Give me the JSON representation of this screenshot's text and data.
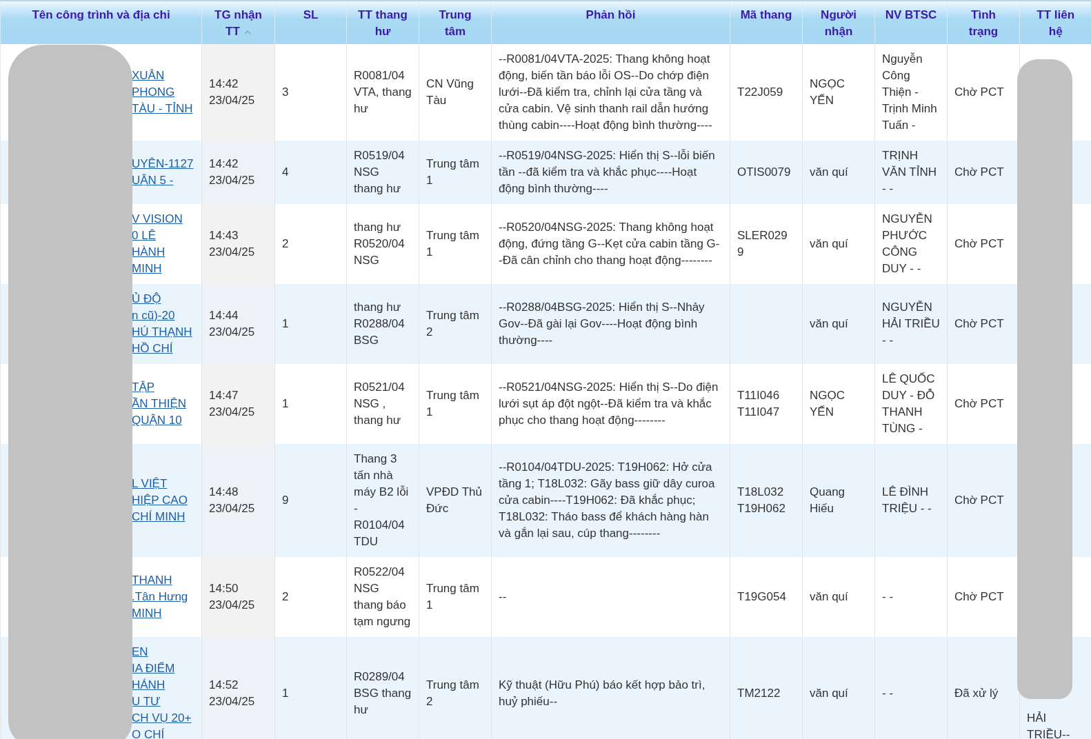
{
  "table": {
    "columns": [
      {
        "label": "Tên công trình và địa chỉ"
      },
      {
        "label": "TG nhận TT",
        "sorted_ascending": true
      },
      {
        "label": "SL"
      },
      {
        "label": "TT thang hư"
      },
      {
        "label": "Trung tâm"
      },
      {
        "label": "Phản hồi"
      },
      {
        "label": "Mã thang"
      },
      {
        "label": "Người nhận"
      },
      {
        "label": "NV BTSC"
      },
      {
        "label": "Tình trạng"
      },
      {
        "label": "TT liên hệ"
      }
    ],
    "rows": [
      {
        "address": [
          "XUÂN",
          "PHONG",
          "TÀU - TỈNH"
        ],
        "time": "14:42",
        "date": "23/04/25",
        "qty": "3",
        "elevator_info": "R0081/04 VTA, thang hư",
        "center": "CN Vũng Tàu",
        "response": "--R0081/04VTA-2025: Thang không hoạt động, biến tần báo lỗi OS--Do chớp điện lưới--Đã kiểm tra, chỉnh lại cửa tầng và cửa cabin. Vệ sinh thanh rail dẫn hướng thùng cabin----Hoạt động bình thường----",
        "code": "T22J059",
        "receiver": "NGỌC YẾN",
        "staff": "Nguyễn Công Thiện - Trịnh Minh Tuấn -",
        "status": "Chờ PCT"
      },
      {
        "address": [
          "UYÊN-1127",
          "UẬN 5 -"
        ],
        "time": "14:42",
        "date": "23/04/25",
        "qty": "4",
        "elevator_info": "R0519/04 NSG thang hư",
        "center": "Trung tâm 1",
        "response": "--R0519/04NSG-2025: Hiển thị S--lỗi biến tần --đã kiểm tra và khắc phục----Hoạt động bình thường----",
        "code": "OTIS0079",
        "receiver": "văn quí",
        "staff": "TRỊNH VĂN TỈNH - -",
        "status": "Chờ PCT"
      },
      {
        "address": [
          "V VISION",
          "0 LÊ",
          "HÀNH",
          "MINH"
        ],
        "time": "14:43",
        "date": "23/04/25",
        "qty": "2",
        "elevator_info": "thang hư R0520/04 NSG",
        "center": "Trung tâm 1",
        "response": "--R0520/04NSG-2025: Thang không hoạt động, đứng tầng G--Kẹt cửa cabin tầng G--Đã cân chỉnh cho thang hoạt động--------",
        "code": "SLER029 9",
        "receiver": "văn quí",
        "staff": "NGUYỄN PHƯỚC CÔNG DUY - -",
        "status": "Chờ PCT"
      },
      {
        "address": [
          "Ủ ĐỘ",
          "n cũ)-20",
          "HÚ THẠNH",
          "HỒ CHÍ"
        ],
        "time": "14:44",
        "date": "23/04/25",
        "qty": "1",
        "elevator_info": "thang hư R0288/04 BSG",
        "center": "Trung tâm 2",
        "response": "--R0288/04BSG-2025: Hiển thị S--Nhảy Gov--Đã gài lại Gov----Hoạt động bình thường----",
        "receiver": "văn quí",
        "staff": "NGUYỄN HẢI TRIỀU - -",
        "status": "Chờ PCT"
      },
      {
        "address": [
          "TẬP",
          "ẦN THIỆN",
          "QUẬN 10"
        ],
        "time": "14:47",
        "date": "23/04/25",
        "qty": "1",
        "elevator_info": "R0521/04 NSG , thang hư",
        "center": "Trung tâm 1",
        "response": "--R0521/04NSG-2025: Hiển thị S--Do điện lưới sụt áp đột ngột--Đã kiểm tra và khắc phục cho thang hoạt động--------",
        "code": "T11I046 T11I047",
        "receiver": "NGỌC YẾN",
        "staff": "LÊ QUỐC DUY - ĐỖ THANH TÙNG -",
        "status": "Chờ PCT"
      },
      {
        "address": [
          "L VIỆT",
          "HIỆP CAO",
          "CHÍ MINH"
        ],
        "time": "14:48",
        "date": "23/04/25",
        "qty": "9",
        "elevator_info": "Thang 3 tấn nhà máy B2 lỗi - R0104/04 TDU",
        "center": "VPĐD Thủ Đức",
        "response": "--R0104/04TDU-2025: T19H062: Hở cửa tầng 1; T18L032: Gãy bass giữ dây curoa cửa cabin----T19H062: Đã khắc phục; T18L032: Tháo bass để khách hàng hàn và gắn lại sau, cúp thang--------",
        "code": "T18L032 T19H062",
        "receiver": "Quang Hiếu",
        "staff": "LÊ ĐÌNH TRIỆU - -",
        "status": "Chờ PCT"
      },
      {
        "address": [
          "THANH",
          ".Tân Hưng",
          "MINH"
        ],
        "time": "14:50",
        "date": "23/04/25",
        "qty": "2",
        "elevator_info": "R0522/04 NSG thang báo tạm ngưng",
        "center": "Trung tâm 1",
        "response": "--",
        "code": "T19G054",
        "receiver": "văn quí",
        "staff": "- -",
        "status": "Chờ PCT"
      },
      {
        "address": [
          "EN",
          "IA ĐIỂM",
          "HÁNH",
          "U TƯ",
          "CH VỤ 20+",
          "O CHÍ"
        ],
        "time": "14:52",
        "date": "23/04/25",
        "qty": "1",
        "elevator_info": "R0289/04 BSG thang hư",
        "center": "Trung tâm 2",
        "response": "Kỹ thuật (Hữu Phú) báo kết hợp bảo trì, huỷ phiếu--",
        "code": "TM2122",
        "receiver": "văn quí",
        "staff": "- -",
        "status": "Đã xử lý",
        "contact": [
          "HẢI",
          "TRIỀU--"
        ]
      }
    ]
  }
}
